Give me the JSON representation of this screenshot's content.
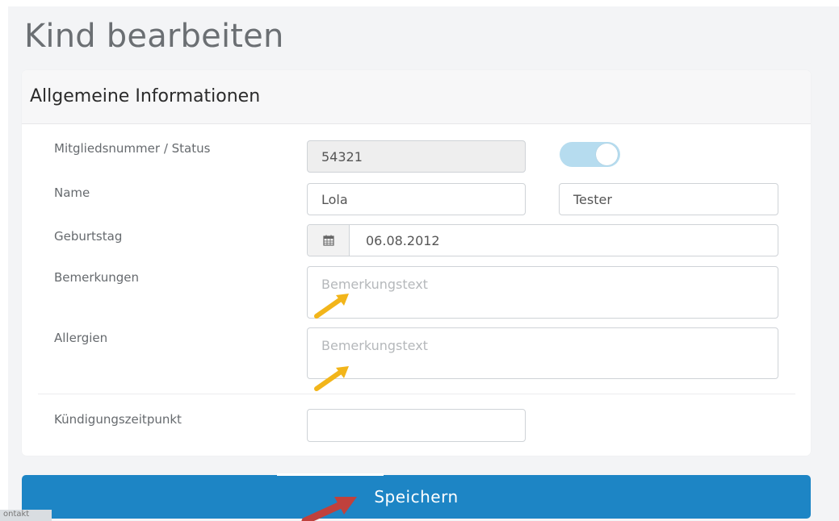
{
  "page": {
    "title": "Kind bearbeiten"
  },
  "panel": {
    "title": "Allgemeine Informationen"
  },
  "form": {
    "member": {
      "label": "Mitgliedsnummer / Status",
      "value": "54321",
      "status_on": true
    },
    "name": {
      "label": "Name",
      "first": "Lola",
      "last": "Tester"
    },
    "birthday": {
      "label": "Geburtstag",
      "value": "06.08.2012",
      "icon": "calendar-icon"
    },
    "remarks": {
      "label": "Bemerkungen",
      "placeholder": "Bemerkungstext"
    },
    "allergies": {
      "label": "Allergien",
      "placeholder": "Bemerkungstext"
    },
    "termination": {
      "label": "Kündigungszeitpunkt",
      "value": ""
    }
  },
  "actions": {
    "save_label": "Speichern"
  },
  "footer": {
    "corner_label": "ontakt"
  },
  "colors": {
    "primary": "#1d85c5",
    "toggle": "#b6dcef",
    "highlight_arrow": "#f2b51a",
    "pointer_arrow": "#c0413c"
  }
}
